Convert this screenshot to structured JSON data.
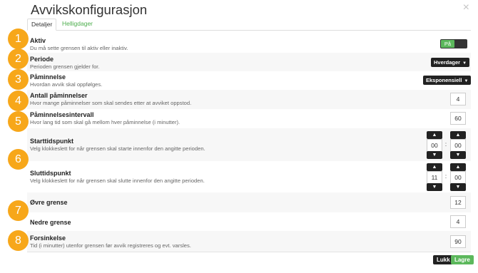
{
  "dialog": {
    "title": "Avvikskonfigurasjon",
    "close_glyph": "×"
  },
  "tabs": [
    {
      "label": "Detaljer"
    },
    {
      "label": "Helligdager"
    }
  ],
  "badges": [
    "1",
    "2",
    "3",
    "4",
    "5",
    "6",
    "7",
    "8"
  ],
  "fields": {
    "active": {
      "label": "Aktiv",
      "desc": "Du må sette grensen til aktiv eller inaktiv.",
      "toggle_on": "På"
    },
    "period": {
      "label": "Periode",
      "desc": "Perioden grensen gjelder for.",
      "value": "Hverdager"
    },
    "reminder": {
      "label": "Påminnelse",
      "desc": "Hvordan avvik skal oppfølges.",
      "value": "Eksponensiell"
    },
    "reminder_count": {
      "label": "Antall påminnelser",
      "desc": "Hvor mange påminnelser som skal sendes etter at avviket oppstod.",
      "value": "4"
    },
    "reminder_interval": {
      "label": "Påminnelsesintervall",
      "desc": "Hvor lang tid som skal gå mellom hver påminnelse (i minutter).",
      "value": "60"
    },
    "start_time": {
      "label": "Starttidspunkt",
      "desc": "Velg klokkeslett for når grensen skal starte innenfor den angitte perioden.",
      "hours": "00",
      "minutes": "00"
    },
    "end_time": {
      "label": "Sluttidspunkt",
      "desc": "Velg klokkeslett for når grensen skal slutte innenfor den angitte perioden.",
      "hours": "11",
      "minutes": "00"
    },
    "upper_limit": {
      "label": "Øvre grense",
      "value": "12"
    },
    "lower_limit": {
      "label": "Nedre grense",
      "value": "4"
    },
    "delay": {
      "label": "Forsinkelse",
      "desc": "Tid (i minutter) utenfor grensen før avvik registreres og evt. varsles.",
      "value": "90"
    }
  },
  "icons": {
    "up": "chevron-up-icon",
    "down": "chevron-down-icon",
    "caret": "caret-down-icon"
  },
  "glyphs": {
    "up": "▲",
    "down": "▼",
    "caret": "▼",
    "colon": ":"
  },
  "footer": {
    "close_label": "Lukk",
    "save_label": "Lagre"
  },
  "colors": {
    "badge": "#f7a71a",
    "accent_green": "#5cb85c",
    "dark": "#222222"
  }
}
